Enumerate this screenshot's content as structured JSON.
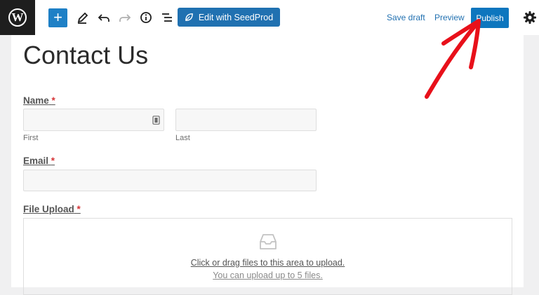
{
  "toolbar": {
    "logo_glyph": "W",
    "add_glyph": "+",
    "seedprod_label": "Edit with SeedProd",
    "save_draft_label": "Save draft",
    "preview_label": "Preview",
    "publish_label": "Publish",
    "icons": [
      "wordpress-logo-icon",
      "plus-icon",
      "pencil-icon",
      "undo-icon",
      "redo-icon",
      "info-icon",
      "list-view-icon",
      "seedprod-leaf-icon",
      "gear-icon"
    ]
  },
  "page": {
    "title": "Contact Us"
  },
  "form": {
    "name": {
      "label": "Name",
      "required_mark": "*",
      "first_sublabel": "First",
      "last_sublabel": "Last"
    },
    "email": {
      "label": "Email",
      "required_mark": "*"
    },
    "file_upload": {
      "label": "File Upload",
      "required_mark": "*",
      "drop_text": "Click or drag files to this area to upload.",
      "limit_text": "You can upload up to 5 files."
    }
  },
  "colors": {
    "primary_blue": "#1e80c6",
    "seedprod_blue": "#2071b1",
    "link_blue": "#2271b1",
    "required_red": "#d63638",
    "annotation_arrow": "#e8101a"
  }
}
